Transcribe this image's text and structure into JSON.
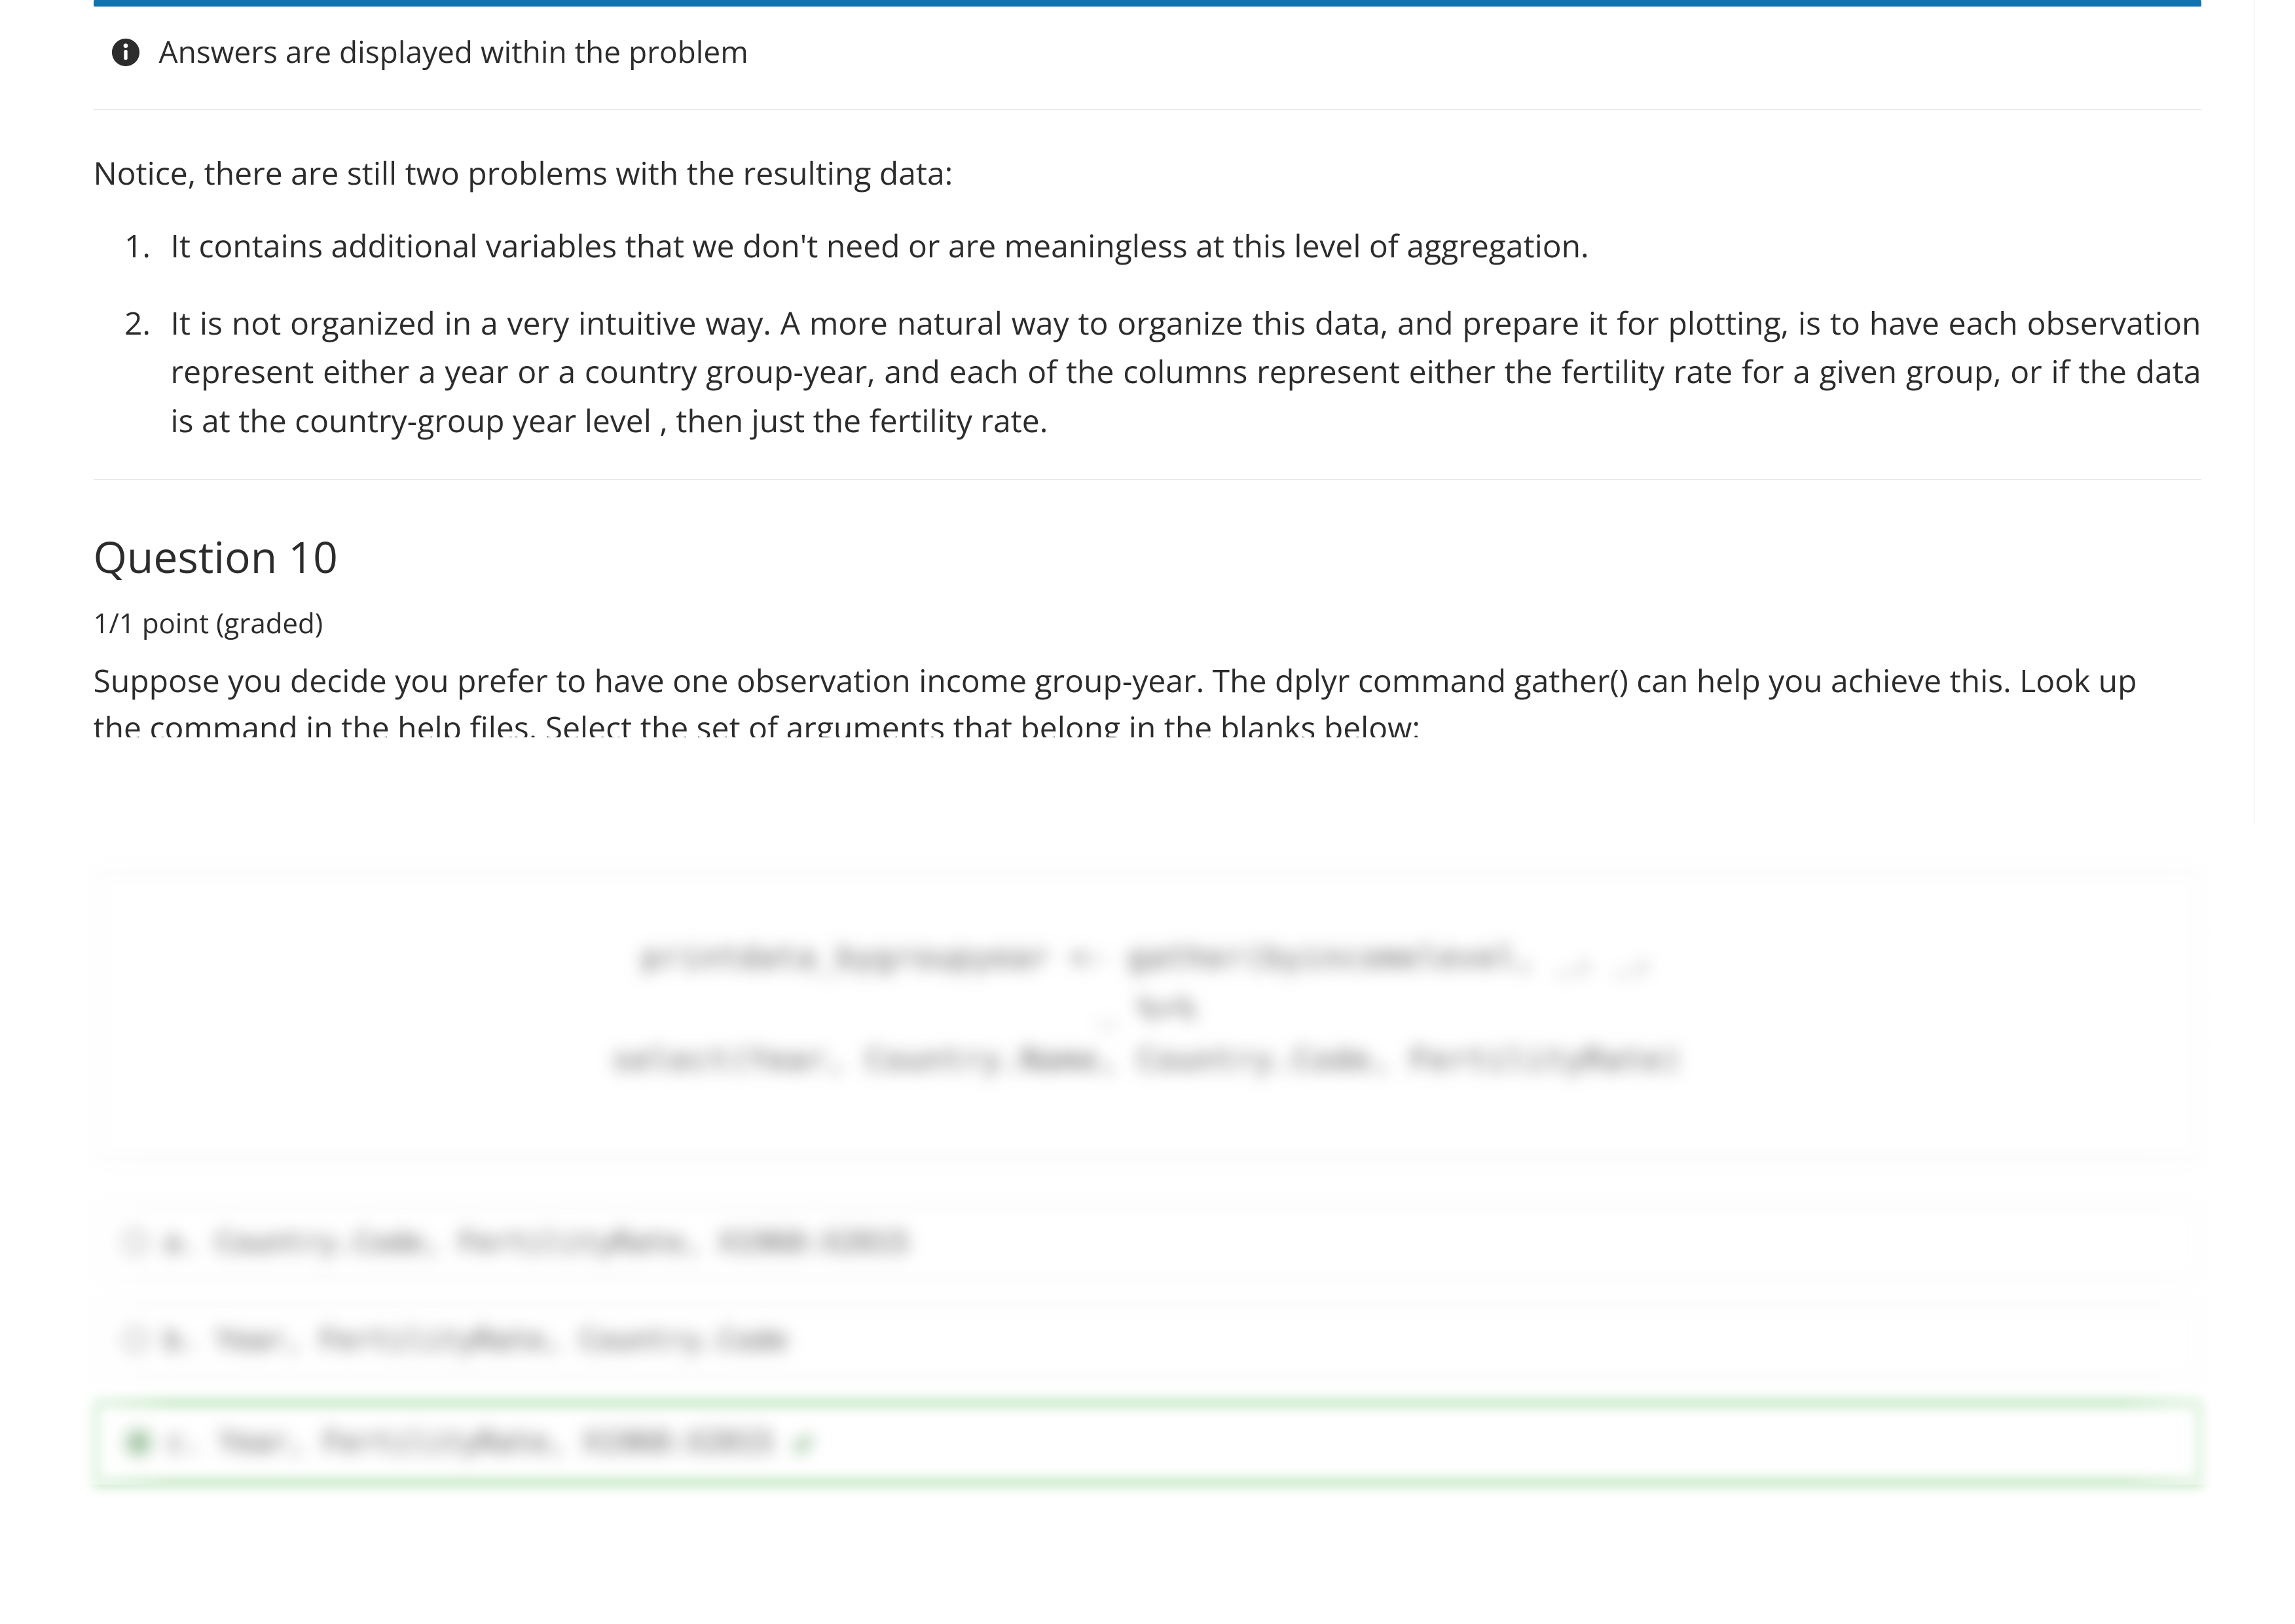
{
  "banner": {
    "text": "Answers are displayed within the problem"
  },
  "intro": {
    "lead": "Notice, there are still two problems with the resulting data:",
    "items": [
      "It contains additional variables that we don't need or are meaningless at this level of aggregation.",
      " It is not organized in a very intuitive way.  A more natural way to organize this data, and prepare it for plotting, is to have each observation represent either a year or a country group-year, and each of the columns represent either the fertility rate for a given group, or if the data is at the country-group year level , then just the fertility rate."
    ]
  },
  "question": {
    "title": "Question 10",
    "points": "1/1 point (graded)",
    "prompt_line1": "Suppose you decide you prefer to have one observation income group-year. The dplyr command gather() can help you achieve this. Look up",
    "prompt_line2_cut": "the command in the help files. Select the set of arguments that belong in the blanks below:"
  },
  "blurred": {
    "code_line1": "printdata_bygroupyear  <-  gather(byincomelevel,  _,  _,",
    "code_line2": "_  %>%",
    "code_line3": "select(Year,  Country.Name,  Country.Code,  FertilityRate)",
    "options": [
      {
        "label": "a. Country.Code, FertilityRate, X1960:X2015",
        "correct": false
      },
      {
        "label": "b. Year, FertilityRate, Country.Code",
        "correct": false
      },
      {
        "label": "c. Year, FertilityRate, X1960:X2015",
        "correct": true
      }
    ]
  }
}
